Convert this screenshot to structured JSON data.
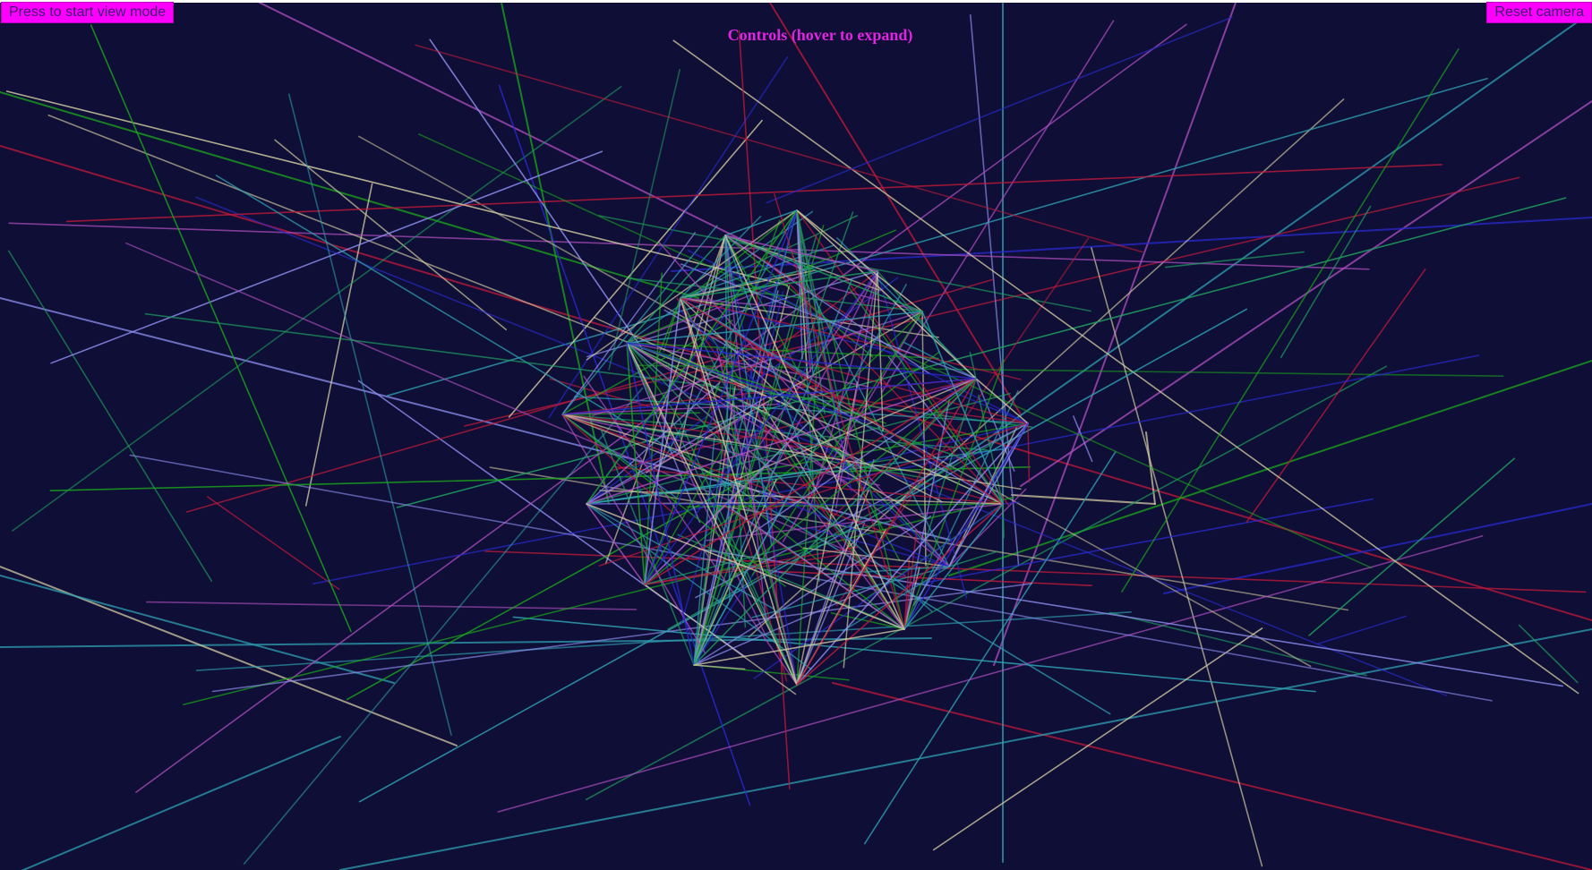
{
  "app": {
    "view_mode_button_label": "Press to start view mode",
    "reset_camera_button_label": "Reset camera",
    "controls_panel_title": "Controls (hover to expand)"
  },
  "colors": {
    "canvas_background": "#0e0e36",
    "button_background": "#ff00ff",
    "button_text": "#3a1a6e",
    "controls_title": "#e024e0",
    "line_palette": [
      "#2f9fb0",
      "#2a2ad0",
      "#1fa060",
      "#1ba81b",
      "#b04fc0",
      "#c01a3a",
      "#d0c8a0",
      "#8f8ff0"
    ]
  }
}
